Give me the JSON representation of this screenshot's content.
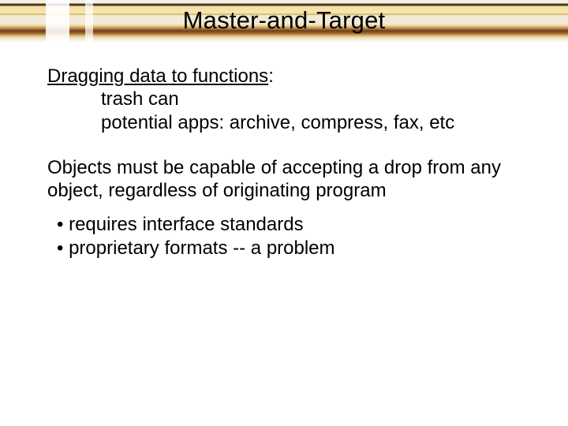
{
  "title": "Master-and-Target",
  "section1": {
    "heading_text": "Dragging data to functions",
    "heading_suffix": ":",
    "items": [
      "trash can",
      "potential apps: archive, compress, fax, etc"
    ]
  },
  "section2": {
    "text": "Objects must be capable of accepting a drop from any object, regardless of originating program"
  },
  "bullets": [
    "requires interface standards",
    "proprietary formats -- a problem"
  ]
}
